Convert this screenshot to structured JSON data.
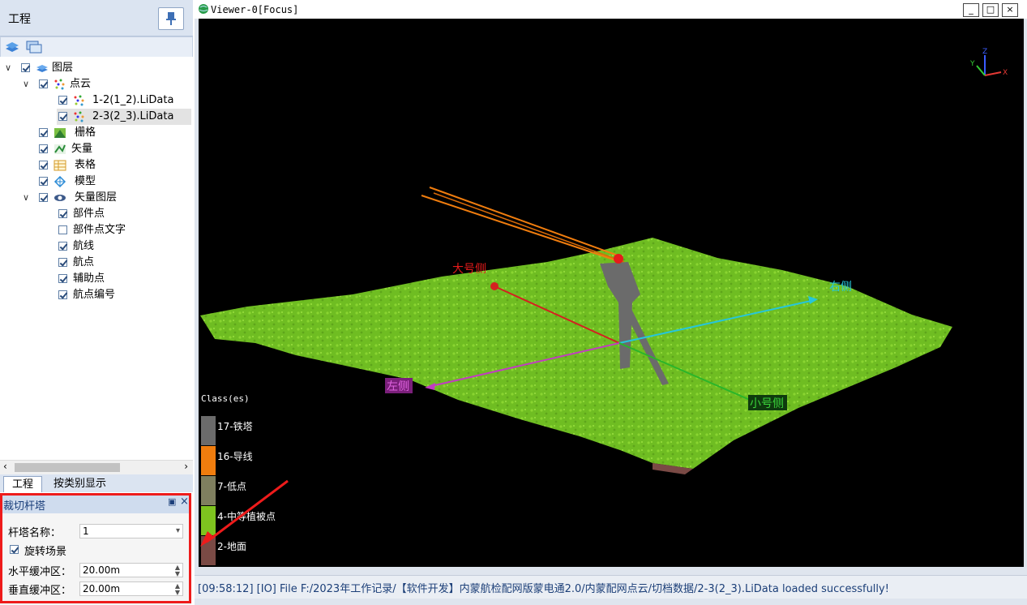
{
  "project_panel": {
    "title": "工程",
    "tree": [
      {
        "label": "图层",
        "icon": "layers-icon"
      },
      {
        "label": "点云",
        "icon": "point-cloud-icon"
      },
      {
        "label": "1-2(1_2).LiData",
        "icon": "point-cloud-file-icon"
      },
      {
        "label": "2-3(2_3).LiData",
        "icon": "point-cloud-file-icon"
      },
      {
        "label": "栅格",
        "icon": "raster-icon"
      },
      {
        "label": "矢量",
        "icon": "vector-icon"
      },
      {
        "label": "表格",
        "icon": "table-icon"
      },
      {
        "label": "模型",
        "icon": "model-icon"
      },
      {
        "label": "矢量图层",
        "icon": "vector-layer-icon"
      },
      {
        "label": "部件点",
        "icon": ""
      },
      {
        "label": "部件点文字",
        "icon": ""
      },
      {
        "label": "航线",
        "icon": ""
      },
      {
        "label": "航点",
        "icon": ""
      },
      {
        "label": "辅助点",
        "icon": ""
      },
      {
        "label": "航点编号",
        "icon": ""
      }
    ],
    "tabs": [
      "工程",
      "按类别显示"
    ]
  },
  "cut_tower": {
    "title": "裁切杆塔",
    "tower_name_label": "杆塔名称：",
    "tower_name_value": "1",
    "rotate_label": "旋转场景",
    "h_buffer_label": "水平缓冲区：",
    "h_buffer_value": "20.00m",
    "v_buffer_label": "垂直缓冲区：",
    "v_buffer_value": "20.00m"
  },
  "viewer": {
    "title": "Viewer-0[Focus]",
    "labels": {
      "big": "大号侧",
      "right": "右侧",
      "left": "左侧",
      "small": "小号侧"
    },
    "axis_gizmo": {
      "x": "X",
      "y": "Y",
      "z": "Z"
    },
    "legend": {
      "title": "Class(es)",
      "items": [
        {
          "label": "17-铁塔",
          "color": "#6b6b6b"
        },
        {
          "label": "16-导线",
          "color": "#f07d0e"
        },
        {
          "label": "7-低点",
          "color": "#7f7f5f"
        },
        {
          "label": "4-中等植被点",
          "color": "#7ec31f"
        },
        {
          "label": "2-地面",
          "color": "#7a4a45"
        }
      ]
    }
  },
  "status_bar": {
    "text": "[09:58:12] [IO]   File F:/2023年工作记录/【软件开发】内蒙航检配网版蒙电通2.0/内蒙配网点云/切档数据/2-3(2_3).LiData loaded successfully!"
  }
}
